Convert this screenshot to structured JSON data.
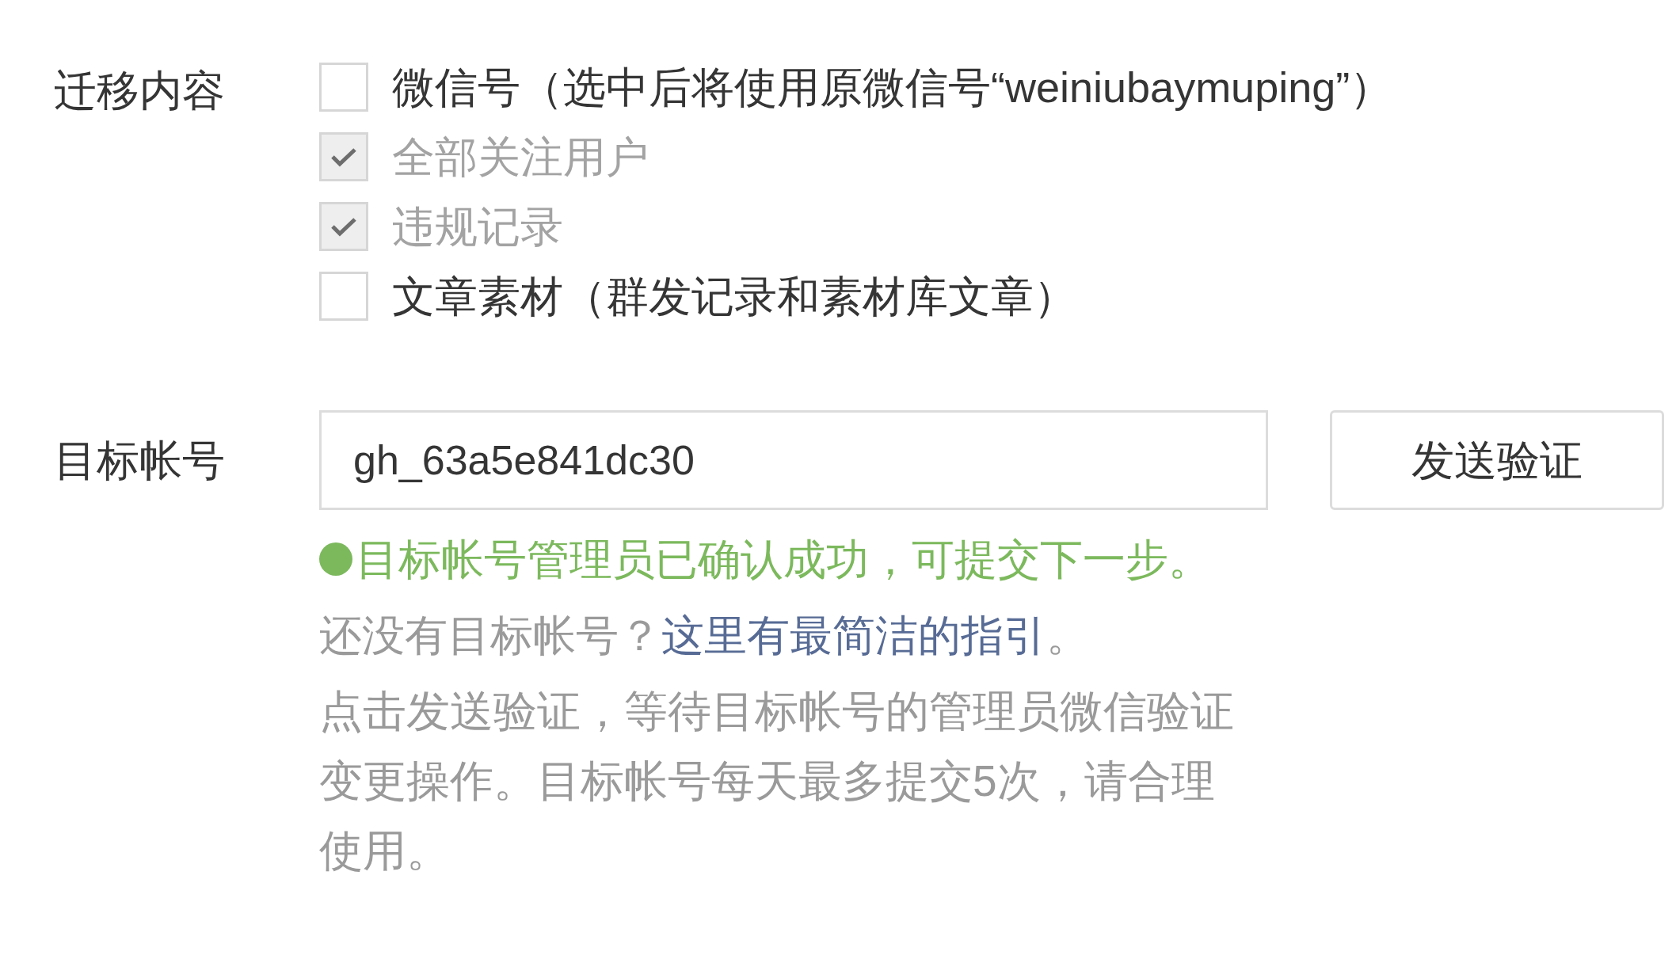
{
  "migration": {
    "label": "迁移内容",
    "options": [
      {
        "label": "微信号（选中后将使用原微信号“weiniubaymuping”）",
        "checked": false,
        "disabled": false
      },
      {
        "label": "全部关注用户",
        "checked": true,
        "disabled": true
      },
      {
        "label": "违规记录",
        "checked": true,
        "disabled": true
      },
      {
        "label": "文章素材（群发记录和素材库文章）",
        "checked": false,
        "disabled": false
      }
    ]
  },
  "target": {
    "label": "目标帐号",
    "value": "gh_63a5e841dc30",
    "button": "发送验证",
    "status": {
      "text": "目标帐号管理员已确认成功，可提交下一步。",
      "color": "#7cb95d"
    },
    "hint": "还没有目标帐号？",
    "link": "这里有最简洁的指引",
    "link_tail": "。",
    "description": "点击发送验证，等待目标帐号的管理员微信验证变更操作。目标帐号每天最多提交5次，请合理使用。"
  }
}
